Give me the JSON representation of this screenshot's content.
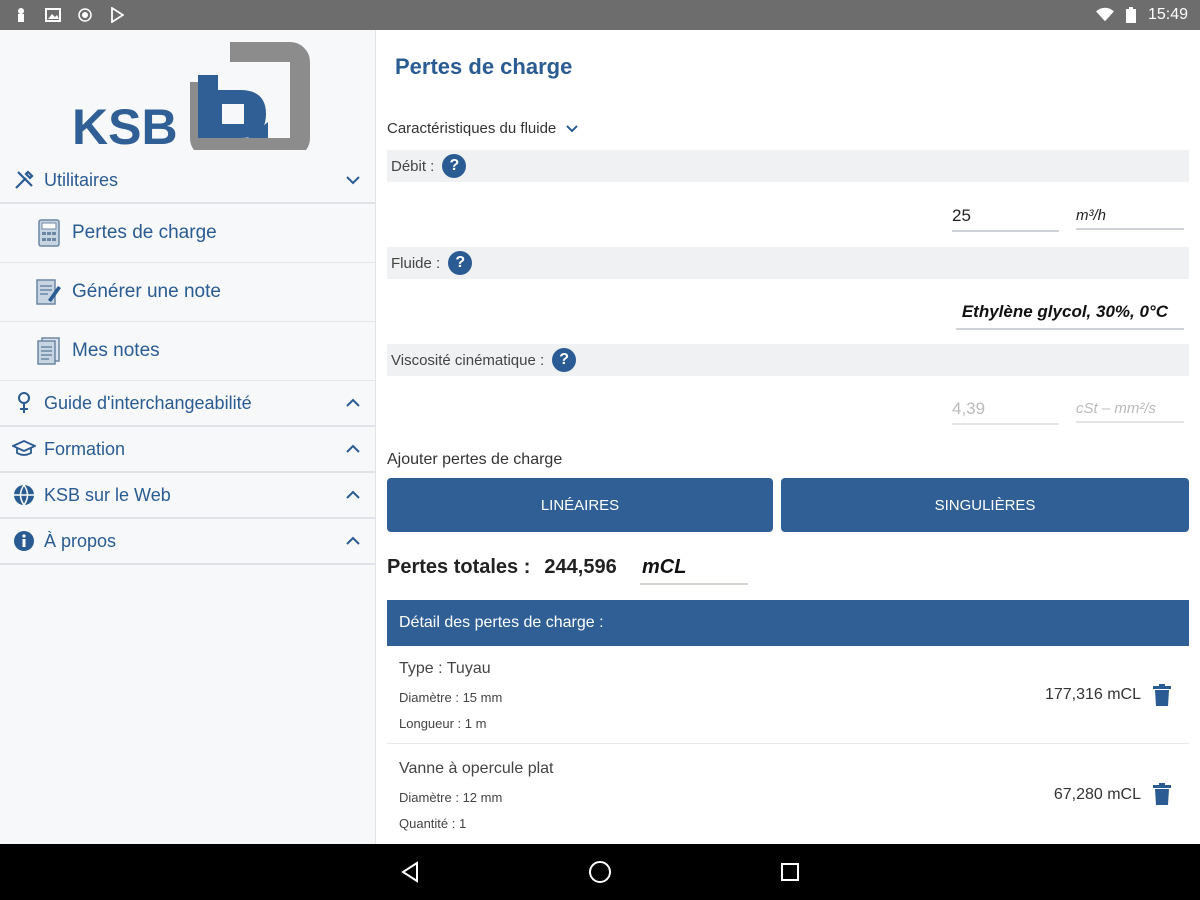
{
  "status_bar": {
    "time": "15:49",
    "left_icons": [
      "notification-icon",
      "image-icon",
      "record-icon",
      "play-store-icon"
    ],
    "right_icons": [
      "wifi-icon",
      "battery-icon"
    ]
  },
  "sidebar": {
    "logo_text": "KSB",
    "sections": [
      {
        "label": "Utilitaires",
        "icon": "tools-icon",
        "expanded": true,
        "children": [
          {
            "label": "Pertes de charge",
            "icon": "calculator-icon"
          },
          {
            "label": "Générer une note",
            "icon": "note-edit-icon"
          },
          {
            "label": "Mes notes",
            "icon": "notes-icon"
          }
        ]
      },
      {
        "label": "Guide d'interchangeabilité",
        "icon": "location-pin-icon",
        "expanded": false
      },
      {
        "label": "Formation",
        "icon": "graduation-cap-icon",
        "expanded": false
      },
      {
        "label": "KSB sur le Web",
        "icon": "web-icon",
        "expanded": false
      },
      {
        "label": "À propos",
        "icon": "info-icon",
        "expanded": false
      }
    ]
  },
  "main": {
    "title": "Pertes de charge",
    "fluid_section_label": "Caractéristiques du fluide",
    "debit": {
      "label": "Débit :",
      "value": "25",
      "unit": "m³/h"
    },
    "fluide": {
      "label": "Fluide :",
      "value": "Ethylène glycol, 30%, 0°C"
    },
    "viscosite": {
      "label": "Viscosité cinématique :",
      "value": "4,39",
      "unit": "cSt – mm²/s"
    },
    "add_label": "Ajouter pertes de charge",
    "btn_lineaires": "LINÉAIRES",
    "btn_singulieres": "SINGULIÈRES",
    "total_label": "Pertes totales :",
    "total_value": "244,596",
    "total_unit": "mCL",
    "detail_header": "Détail des pertes de charge :",
    "details": [
      {
        "type": "Type : Tuyau",
        "line1": "Diamètre : 15 mm",
        "line2": "Longueur : 1 m",
        "value": "177,316 mCL"
      },
      {
        "type": "Vanne à opercule plat",
        "line1": "Diamètre : 12 mm",
        "line2": "Quantité : 1",
        "value": "67,280 mCL"
      }
    ]
  },
  "colors": {
    "primary": "#2f5f95",
    "text_blue": "#2a5b92",
    "logo_grey": "#8c8c8c"
  }
}
